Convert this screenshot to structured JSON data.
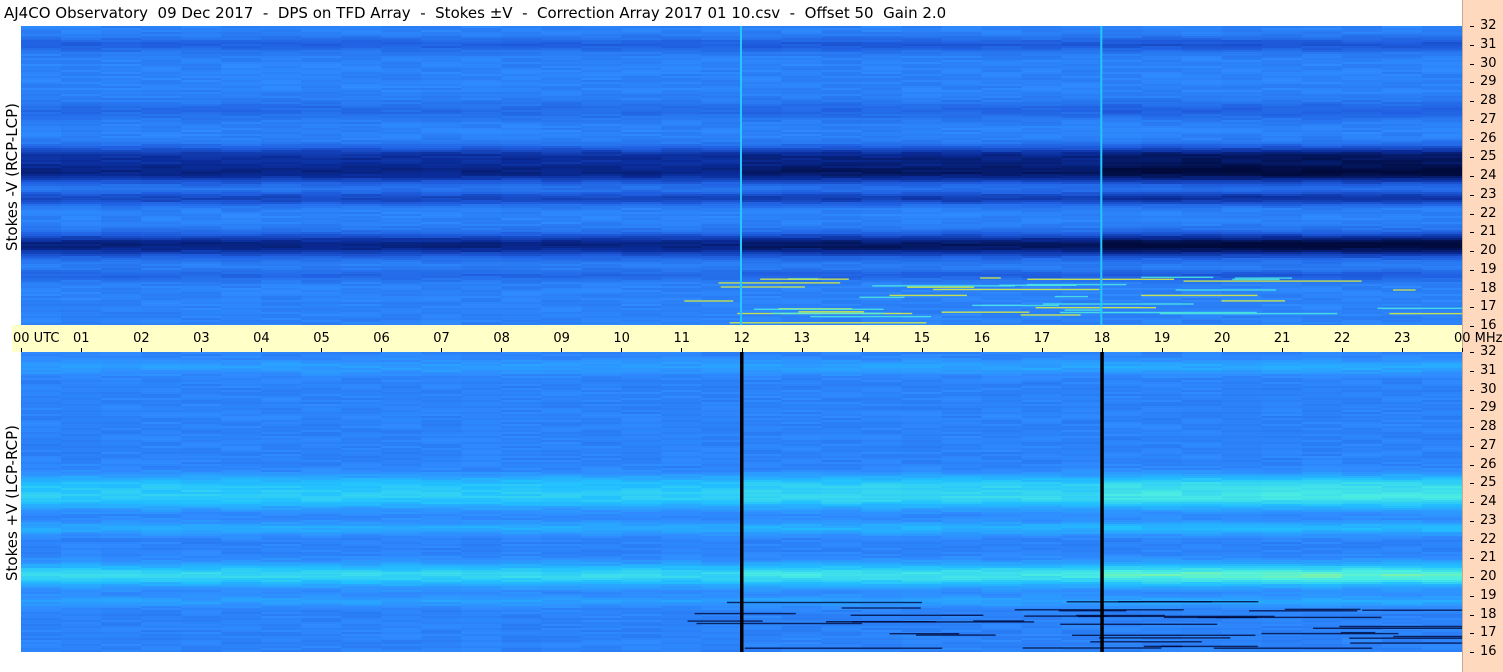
{
  "header": {
    "title": "AJ4CO Observatory  09 Dec 2017  -  DPS on TFD Array  -  Stokes ±V  -  Correction Array 2017 01 10.csv  -  Offset 50  Gain 2.0"
  },
  "colors": {
    "background": "#ffffff",
    "time_bar": "#ffffc8",
    "right_strip": "#ffd9bd",
    "colormap": [
      "#000a3c",
      "#0a2c9a",
      "#1f5ee0",
      "#2f8cff",
      "#22c0ff",
      "#4ef0e0",
      "#e8f830",
      "#ff6a20"
    ]
  },
  "chart_data": [
    {
      "type": "heatmap",
      "ylabel": "Stokes -V (RCP-LCP)",
      "x_unit": "UTC",
      "y_unit": "MHz",
      "xlim": [
        0,
        24
      ],
      "ylim": [
        16,
        32
      ],
      "dark_bands_mhz": [
        {
          "center": 31.0,
          "width": 0.4,
          "strength": 0.35
        },
        {
          "center": 27.5,
          "width": 0.5,
          "strength": 0.25
        },
        {
          "center": 25.1,
          "width": 0.5,
          "strength": 0.7
        },
        {
          "center": 24.2,
          "width": 0.6,
          "strength": 0.95
        },
        {
          "center": 22.8,
          "width": 0.35,
          "strength": 0.6
        },
        {
          "center": 20.3,
          "width": 0.6,
          "strength": 1.0
        },
        {
          "center": 18.7,
          "width": 0.3,
          "strength": 0.3
        }
      ],
      "vertical_lines_utc": [
        12.0,
        18.0
      ],
      "vertical_line_color": "#22c8ff",
      "notes": "vertical artifact lines at 12 and 18 UTC"
    },
    {
      "type": "heatmap",
      "ylabel": "Stokes +V (LCP-RCP)",
      "x_unit": "UTC",
      "y_unit": "MHz",
      "xlim": [
        0,
        24
      ],
      "ylim": [
        16,
        32
      ],
      "bright_bands_mhz": [
        {
          "center": 31.2,
          "width": 0.4,
          "strength": 0.3
        },
        {
          "center": 25.0,
          "width": 0.5,
          "strength": 0.55
        },
        {
          "center": 24.2,
          "width": 0.6,
          "strength": 0.75
        },
        {
          "center": 22.6,
          "width": 0.35,
          "strength": 0.45
        },
        {
          "center": 20.1,
          "width": 0.6,
          "strength": 0.95
        },
        {
          "center": 18.7,
          "width": 0.3,
          "strength": 0.3
        }
      ],
      "vertical_lines_utc": [
        12.0,
        18.0
      ],
      "vertical_line_color": "#000000"
    }
  ],
  "axes": {
    "time_labels": [
      "00 UTC",
      "01",
      "02",
      "03",
      "04",
      "05",
      "06",
      "07",
      "08",
      "09",
      "10",
      "11",
      "12",
      "13",
      "14",
      "15",
      "16",
      "17",
      "18",
      "19",
      "20",
      "21",
      "22",
      "23",
      "00 MHz"
    ],
    "freq_labels": [
      "32",
      "31",
      "30",
      "29",
      "28",
      "27",
      "26",
      "25",
      "24",
      "23",
      "22",
      "21",
      "20",
      "19",
      "18",
      "17",
      "16"
    ]
  }
}
